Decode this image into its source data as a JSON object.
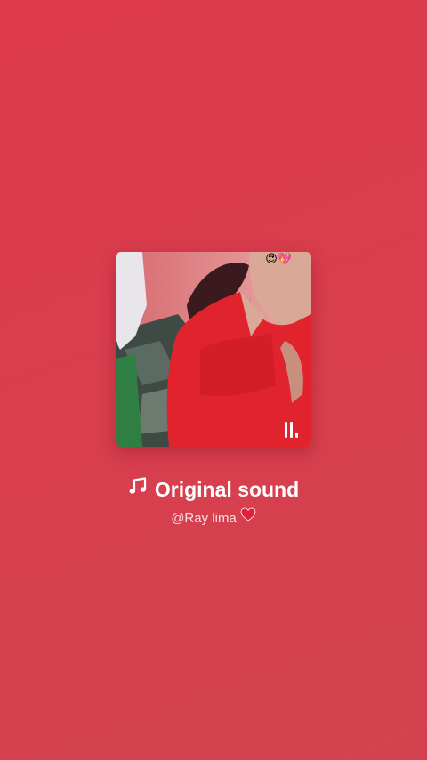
{
  "colors": {
    "background": "#d93e4e",
    "text": "#ffffff",
    "heart": "#e0203a"
  },
  "cover": {
    "overlay_emoji": "😍💖",
    "playing_indicator_icon": "equalizer-bars-icon"
  },
  "track": {
    "icon": "music-note-icon",
    "title": "Original sound",
    "author": "@Ray lima",
    "author_icon": "red-heart-icon"
  }
}
